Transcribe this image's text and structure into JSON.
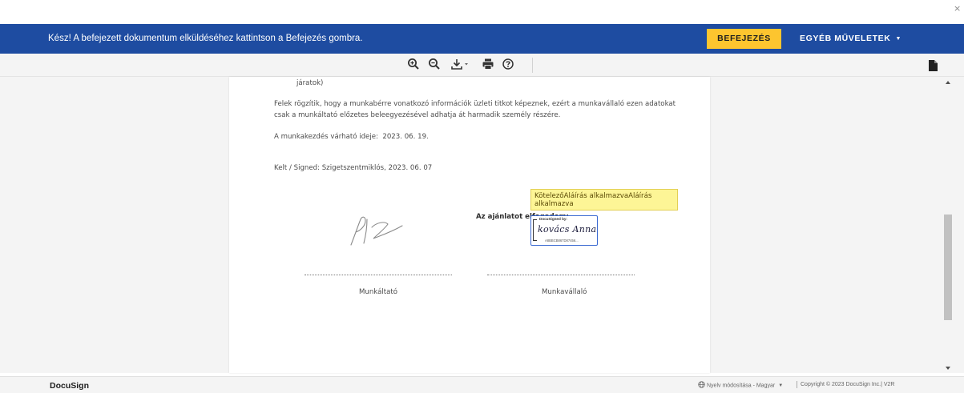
{
  "window": {
    "close_glyph": "×"
  },
  "topbar": {
    "message": "Kész! A befejezett dokumentum elküldéséhez kattintson a Befejezés gombra.",
    "finish_label": "BEFEJEZÉS",
    "more_label": "EGYÉB MŰVELETEK",
    "more_caret": "▼",
    "bg_color": "#1e4ca1",
    "finish_color": "#fdc52f"
  },
  "toolbar": {
    "tools": [
      {
        "icon": "zoom-in-icon"
      },
      {
        "icon": "zoom-out-icon"
      },
      {
        "icon": "download-icon"
      },
      {
        "icon": "print-icon"
      },
      {
        "icon": "help-icon"
      }
    ],
    "right_icon": "document-icon"
  },
  "document": {
    "line_jaratok": "járatok)",
    "para_line1": "Felek rögzítik, hogy a munkabérre vonatkozó információk üzleti titkot képeznek, ezért a munkavállaló ezen adatokat",
    "para_line2": "csak a munkáltató előzetes beleegyezésével adhatja át harmadik személy részére.",
    "start_date_label": "A munkakezdés várható ideje:",
    "start_date_value": "2023. 06. 19.",
    "signed_line": "Kelt / Signed:  Szigetszentmiklós, 2023. 06. 07",
    "sign_tag": "KötelezőAláírás alkalmazvaAláírás alkalmazva",
    "accept_label": "Az ajánlatot elfogadom:",
    "signature": {
      "signed_by": "DocuSigned by:",
      "name": "kovács Anna",
      "hash": "A8BBCB867D87456..."
    },
    "employer_label": "Munkáltató",
    "employee_label": "Munkavállaló"
  },
  "footer": {
    "brand": "DocuSign",
    "language": "Nyelv módosítása - Magyar",
    "language_caret": "▼",
    "copyright": "Copyright © 2023 DocuSign Inc.| V2R"
  }
}
